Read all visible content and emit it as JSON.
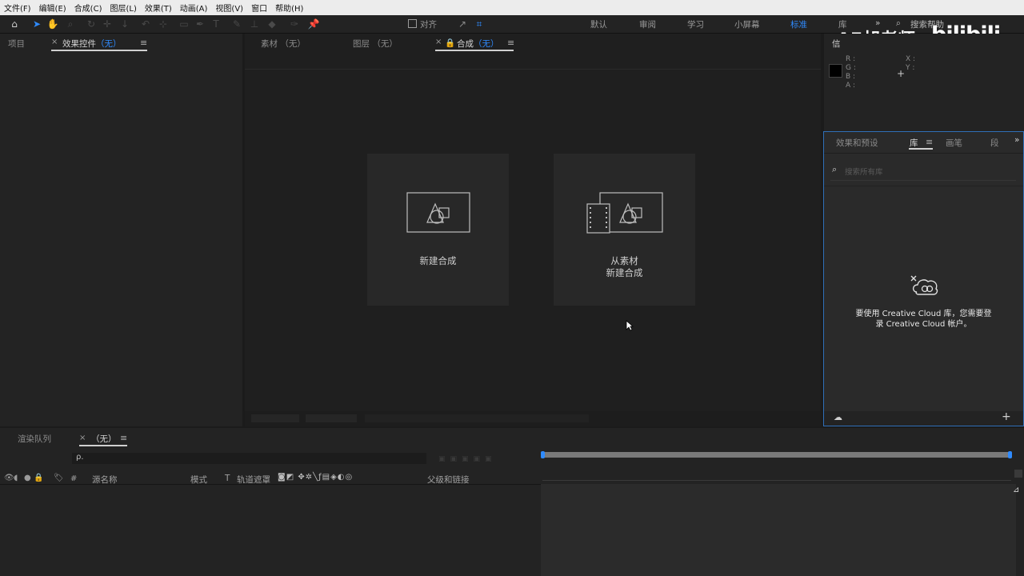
{
  "menu": [
    "文件(F)",
    "编辑(E)",
    "合成(C)",
    "图层(L)",
    "效果(T)",
    "动画(A)",
    "视图(V)",
    "窗口",
    "帮助(H)"
  ],
  "toolbar": {
    "align_label": "对齐",
    "workspaces": [
      "默认",
      "审阅",
      "学习",
      "小屏幕",
      "标准",
      "库"
    ],
    "active_workspace": "标准",
    "search_placeholder": "搜索帮助"
  },
  "watermark": {
    "text": "AE胡老师",
    "logo": "bilibili"
  },
  "left_panel": {
    "tabs": [
      {
        "label": "项目"
      },
      {
        "label": "效果控件",
        "suffix": "（无）"
      }
    ]
  },
  "viewer": {
    "tabs": [
      {
        "label": "素材",
        "suffix": "（无）"
      },
      {
        "label": "图层",
        "suffix": "（无）"
      },
      {
        "label": "合成",
        "suffix": "（无）"
      }
    ],
    "card_new": {
      "label": "新建合成"
    },
    "card_from_footage": {
      "line1": "从素材",
      "line2": "新建合成"
    }
  },
  "info_panel": {
    "tab_label": "信",
    "rgba_labels": [
      "R :",
      "G :",
      "B :",
      "A :"
    ],
    "xy_labels": [
      "X :",
      "Y :"
    ]
  },
  "library_panel": {
    "tabs": [
      "效果和预设",
      "库",
      "画笔",
      "段"
    ],
    "active_tab": "库",
    "search_placeholder": "搜索所有库",
    "message_line1": "要使用 Creative Cloud 库，您需要登",
    "message_line2": "录 Creative Cloud 帐户。"
  },
  "timeline": {
    "tabs": [
      {
        "label": "渲染队列"
      },
      {
        "label": "（无）"
      }
    ],
    "search_icon_text": "ρ.",
    "columns": {
      "hash": "#",
      "source_name": "源名称",
      "mode": "模式",
      "t": "T",
      "track_matte": "轨道遮罩",
      "parent": "父级和链接"
    }
  },
  "colors": {
    "accent": "#2f8bff",
    "menubar_bg": "#ececec",
    "panel_bg": "#232323",
    "viewer_bg": "#1f1f1f",
    "library_bg": "#2a2a2a"
  }
}
